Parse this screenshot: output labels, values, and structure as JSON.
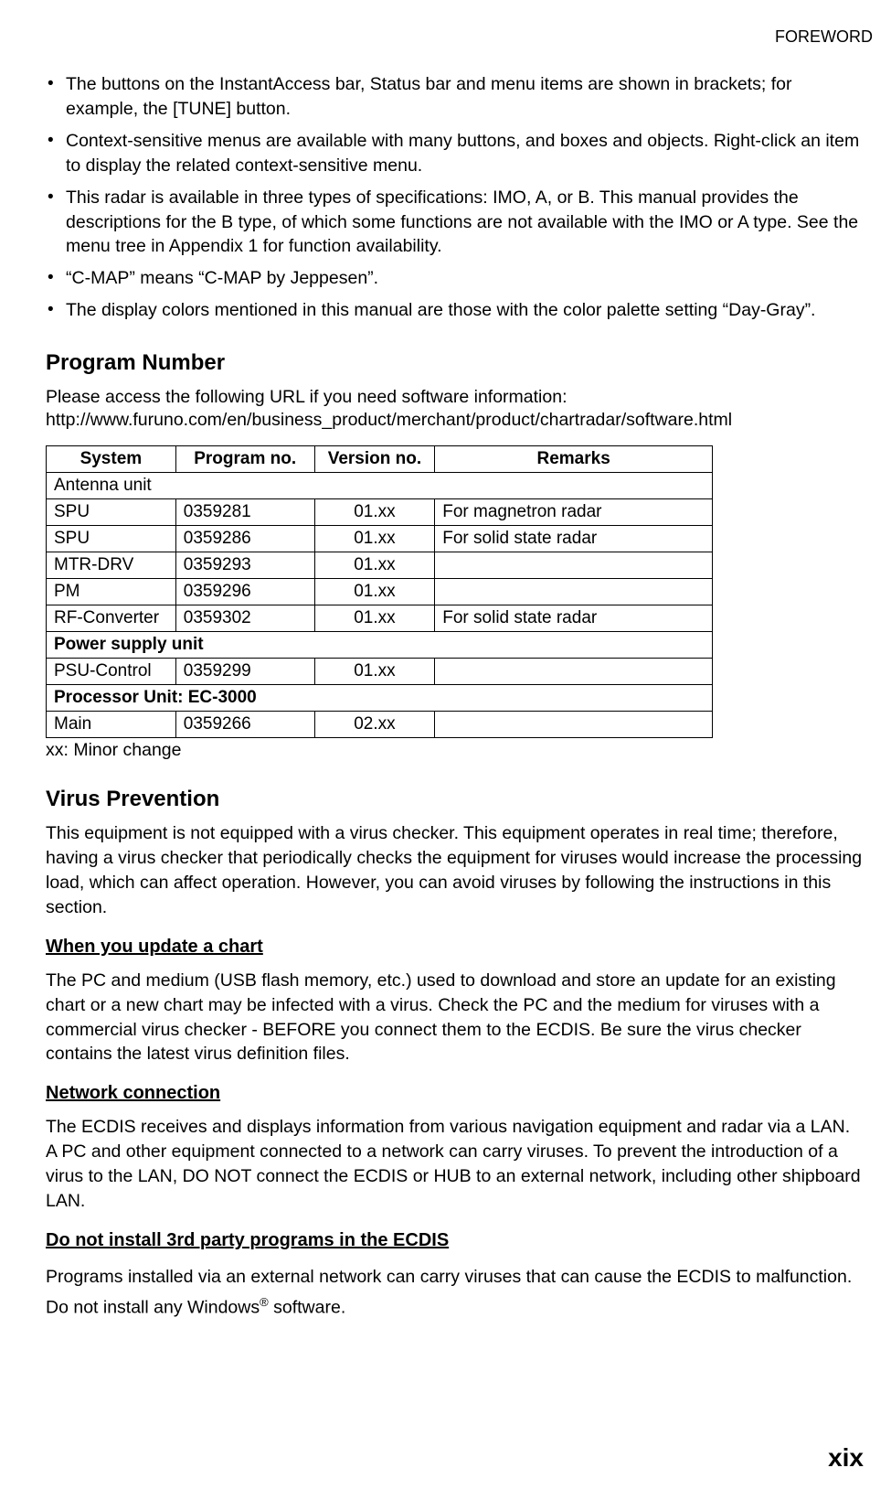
{
  "header": "FOREWORD",
  "bullets": [
    "The buttons on the InstantAccess bar, Status bar and menu items are shown in brackets; for example, the [TUNE] button.",
    "Context-sensitive menus are available with many buttons, and boxes and objects. Right-click an item to display the related context-sensitive menu.",
    "This radar is available in three types of specifications: IMO, A, or B. This manual provides the descriptions for the B type, of which some functions are not available with the IMO or A type. See the menu tree in Appendix 1 for function availability.",
    "“C-MAP” means “C-MAP by Jeppesen”.",
    "The display colors mentioned in this manual are those with the color palette setting “Day-Gray”."
  ],
  "program_number": {
    "heading": "Program Number",
    "intro": "Please access the following URL if you need software information:",
    "url": "http://www.furuno.com/en/business_product/merchant/product/chartradar/software.html",
    "table_headers": [
      "System",
      "Program no.",
      "Version no.",
      "Remarks"
    ],
    "rows": [
      {
        "type": "section",
        "label": "Antenna unit",
        "bold": false
      },
      {
        "type": "data",
        "system": "SPU",
        "program": "0359281",
        "version": "01.xx",
        "remarks": "For magnetron radar"
      },
      {
        "type": "data",
        "system": "SPU",
        "program": "0359286",
        "version": "01.xx",
        "remarks": "For solid state radar"
      },
      {
        "type": "data",
        "system": "MTR-DRV",
        "program": "0359293",
        "version": "01.xx",
        "remarks": ""
      },
      {
        "type": "data",
        "system": "PM",
        "program": "0359296",
        "version": "01.xx",
        "remarks": ""
      },
      {
        "type": "data",
        "system": "RF-Converter",
        "program": "0359302",
        "version": "01.xx",
        "remarks": "For solid state radar"
      },
      {
        "type": "section",
        "label": "Power supply unit",
        "bold": true
      },
      {
        "type": "data",
        "system": "PSU-Control",
        "program": "0359299",
        "version": "01.xx",
        "remarks": ""
      },
      {
        "type": "section",
        "label": "Processor Unit: EC-3000",
        "bold": true
      },
      {
        "type": "data",
        "system": "Main",
        "program": "0359266",
        "version": "02.xx",
        "remarks": ""
      }
    ],
    "note": "xx: Minor change"
  },
  "virus_prevention": {
    "heading": "Virus Prevention",
    "intro": "This equipment is not equipped with a virus checker. This equipment operates in real time; therefore, having a virus checker that periodically checks the equipment for viruses would increase the processing load, which can affect operation. However, you can avoid viruses by following the instructions in this section.",
    "sections": [
      {
        "title": "When you update a chart",
        "body": "The PC and medium (USB flash memory, etc.) used to download and store an update for an existing chart or a new chart may be infected with a virus. Check the PC and the medium for viruses with a commercial virus checker - BEFORE you connect them to the ECDIS. Be sure the virus checker contains the latest virus definition files."
      },
      {
        "title": "Network connection",
        "body": "The ECDIS receives and displays information from various navigation equipment and radar via a LAN. A PC and other equipment connected to a network can carry viruses. To prevent the introduction of a virus to the LAN, DO NOT connect the ECDIS or HUB to an external network, including other shipboard LAN."
      },
      {
        "title": "Do not install 3rd party programs in the ECDIS",
        "body_pre": "Programs installed via an external network can carry viruses that can cause the ECDIS to malfunction. Do not install any Windows",
        "super": "®",
        "body_post": " software."
      }
    ]
  },
  "page_number": "xix"
}
